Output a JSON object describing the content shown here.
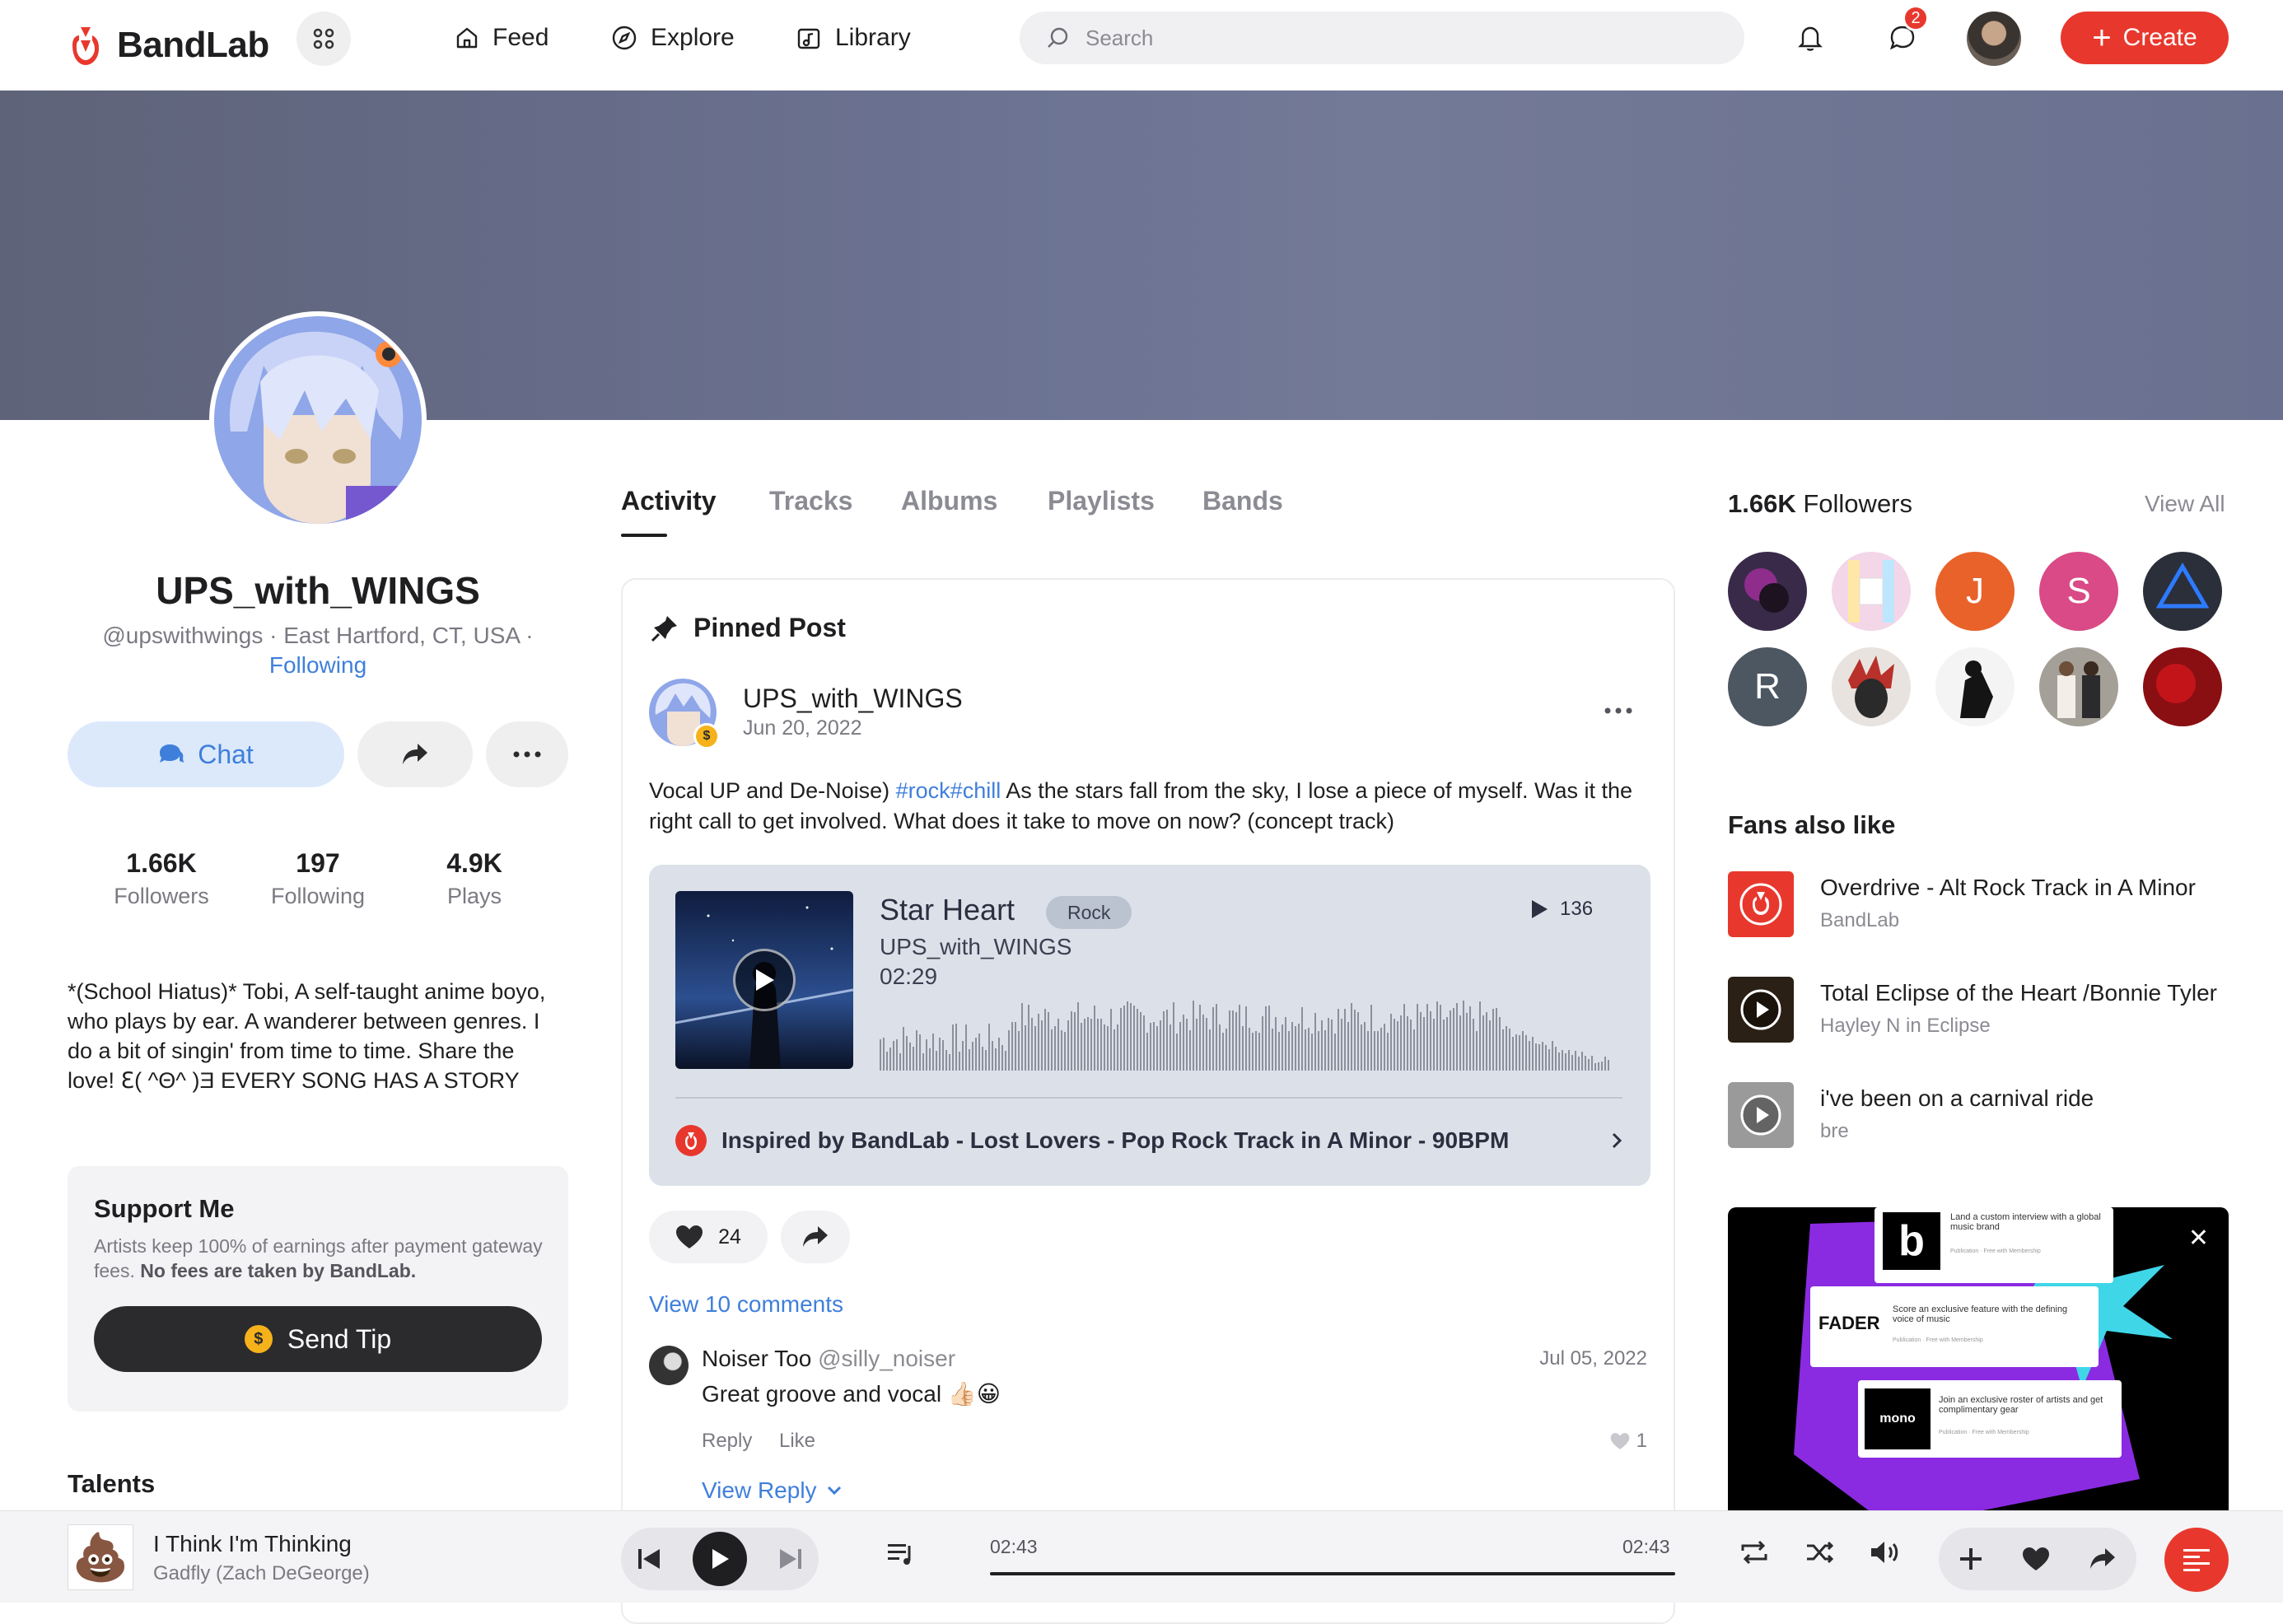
{
  "nav": {
    "brand": "BandLab",
    "items": [
      {
        "label": "Feed",
        "icon": "home-icon"
      },
      {
        "label": "Explore",
        "icon": "compass-icon"
      },
      {
        "label": "Library",
        "icon": "library-icon"
      }
    ],
    "search_placeholder": "Search",
    "messages_badge": "2",
    "create_label": "Create"
  },
  "profile": {
    "name": "UPS_with_WINGS",
    "meta": "@upswithwings · East Hartford, CT, USA ·",
    "following_status": "Following",
    "chat_label": "Chat",
    "stats": [
      {
        "value": "1.66K",
        "label": "Followers"
      },
      {
        "value": "197",
        "label": "Following"
      },
      {
        "value": "4.9K",
        "label": "Plays"
      }
    ],
    "bio": "*(School Hiatus)* Tobi, A self-taught anime boyo, who plays by ear. A wanderer between genres. I do a bit of singin' from time to time. Share the love! ℇ( ^Θ^ )Ǝ EVERY SONG HAS A STORY",
    "support": {
      "title": "Support Me",
      "desc": "Artists keep 100% of earnings after payment gateway fees.",
      "desc_bold": "No fees are taken by BandLab.",
      "button": "Send Tip"
    },
    "talents_title": "Talents"
  },
  "tabs": [
    "Activity",
    "Tracks",
    "Albums",
    "Playlists",
    "Bands"
  ],
  "post": {
    "pinned_label": "Pinned Post",
    "author": "UPS_with_WINGS",
    "date": "Jun 20, 2022",
    "text_before": "Vocal UP and De-Noise) ",
    "tags": "#rock#chill",
    "text_after": " As the stars fall from the sky, I lose a piece of myself. Was it the right call to get involved. What does it take to move on now? (concept track)",
    "track": {
      "title": "Star Heart",
      "genre": "Rock",
      "plays": "136",
      "artist": "UPS_with_WINGS",
      "duration": "02:29",
      "inspired": "Inspired by BandLab - Lost Lovers - Pop Rock Track in A Minor - 90BPM"
    },
    "likes": "24",
    "view_comments": "View 10 comments",
    "comment": {
      "name": "Noiser Too",
      "handle": "@silly_noiser",
      "date": "Jul 05, 2022",
      "text": "Great groove and vocal 👍🏻😀",
      "reply": "Reply",
      "like": "Like",
      "likes": "1",
      "view_reply": "View Reply"
    }
  },
  "followers": {
    "count": "1.66K",
    "label": "Followers",
    "view_all": "View All",
    "avatars": [
      {
        "letter": "",
        "color": "#3a2a4a"
      },
      {
        "letter": "",
        "color": "#f3d6e8"
      },
      {
        "letter": "J",
        "color": "#e8622a"
      },
      {
        "letter": "S",
        "color": "#d94a86"
      },
      {
        "letter": "",
        "color": "#2a2f3a"
      },
      {
        "letter": "R",
        "color": "#4d5762"
      },
      {
        "letter": "",
        "color": "#e9e3e0"
      },
      {
        "letter": "",
        "color": "#f4f4f4"
      },
      {
        "letter": "",
        "color": "#a4a098"
      },
      {
        "letter": "",
        "color": "#8a0f12"
      }
    ]
  },
  "fans_also_like": {
    "title": "Fans also like",
    "items": [
      {
        "title": "Overdrive - Alt Rock Track in A Minor",
        "sub": "BandLab",
        "thumb": "#e8382d"
      },
      {
        "title": "Total Eclipse of the Heart /Bonnie Tyler",
        "sub": "Hayley N in Eclipse",
        "thumb": "#2b2015"
      },
      {
        "title": "i've been on a carnival ride",
        "sub": "bre",
        "thumb": "#9a9a9a"
      }
    ]
  },
  "ad": {
    "card1": "Land a custom interview with a global music brand",
    "card1_logo": "b",
    "card2": "Score an exclusive feature with the defining voice of music",
    "card2_logo": "FADER",
    "card3": "Join an exclusive roster of artists and get complimentary gear",
    "card3_logo": "mono",
    "card_footer": "Publication · Free with Membership"
  },
  "player": {
    "title": "I Think I'm Thinking",
    "artist": "Gadfly (Zach DeGeorge)",
    "current": "02:43",
    "total": "02:43",
    "progress": 1.0,
    "cover_glyph": "💩"
  },
  "colors": {
    "brand": "#e8382d",
    "link": "#3f7fdb"
  }
}
